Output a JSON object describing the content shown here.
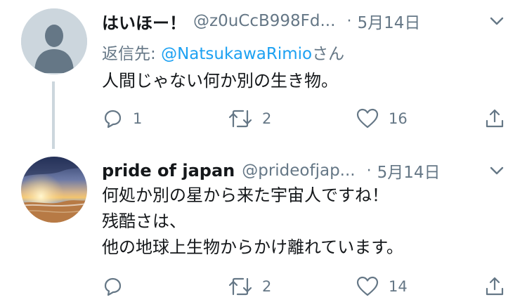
{
  "tweets": [
    {
      "display_name": "はいほー！",
      "handle": "@z0uCcB998Fd...",
      "separator": "·",
      "date": "5月14日",
      "reply_label": "返信先: ",
      "reply_mention": "@NatsukawaRimio",
      "reply_suffix": "さん",
      "lines": [
        "人間じゃない何か別の生き物。"
      ],
      "reply_count": "1",
      "retweet_count": "2",
      "like_count": "16",
      "avatar": "default-avatar-icon"
    },
    {
      "display_name": "pride of japan",
      "handle": "@prideofjap...",
      "separator": "·",
      "date": "5月14日",
      "lines": [
        "何処か別の星から来た宇宙人ですね！",
        "残酷さは、",
        "他の地球上生物からかけ離れています。"
      ],
      "reply_count": "",
      "retweet_count": "2",
      "like_count": "14",
      "avatar": "sunset-beach-avatar"
    }
  ],
  "colors": {
    "text": "#14171a",
    "secondary": "#657786",
    "link": "#1da1f2",
    "thread_line": "#ccd6dd",
    "default_avatar_bg": "#ccd6dd",
    "default_avatar_fg": "#657786"
  }
}
